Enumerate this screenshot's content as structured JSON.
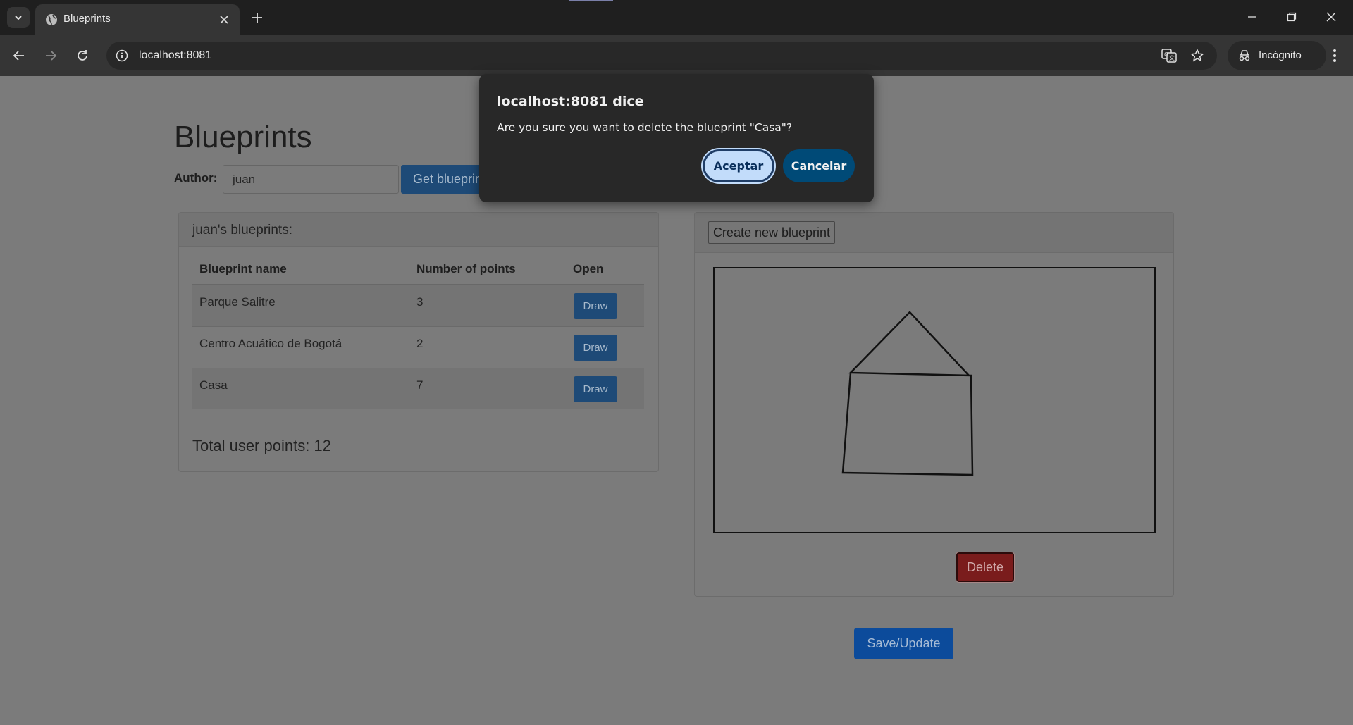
{
  "browser": {
    "tab_title": "Blueprints",
    "url": "localhost:8081",
    "incognito_label": "Incógnito",
    "icons": {
      "tab_list": "chevron-down-icon",
      "favicon": "globe-icon",
      "tab_close": "close-icon",
      "new_tab": "plus-icon",
      "minimize": "minimize-icon",
      "restore": "restore-icon",
      "close_window": "close-icon",
      "back": "arrow-left-icon",
      "forward": "arrow-right-icon",
      "reload": "reload-icon",
      "site_info": "info-icon",
      "translate": "translate-icon",
      "bookmark": "star-icon",
      "incognito": "incognito-icon",
      "menu": "kebab-menu-icon"
    }
  },
  "page": {
    "title": "Blueprints",
    "author_label": "Author:",
    "author_value": "juan",
    "get_button": "Get blueprints",
    "list_panel": {
      "heading": "juan's blueprints:",
      "columns": [
        "Blueprint name",
        "Number of points",
        "Open"
      ],
      "rows": [
        {
          "name": "Parque Salitre",
          "points": "3",
          "action": "Draw"
        },
        {
          "name": "Centro Acuático de Bogotá",
          "points": "2",
          "action": "Draw"
        },
        {
          "name": "Casa",
          "points": "7",
          "action": "Draw"
        }
      ],
      "total": "Total user points: 12"
    },
    "editor_panel": {
      "create_button": "Create new blueprint",
      "save_button": "Save/Update",
      "delete_button": "Delete"
    }
  },
  "dialog": {
    "title": "localhost:8081 dice",
    "message": "Are you sure you want to delete the blueprint \"Casa\"?",
    "ok_button": "Aceptar",
    "cancel_button": "Cancelar"
  },
  "colors": {
    "chrome_dark": "#1f1f1f",
    "toolbar": "#353535",
    "overlay_page": "#7b7b7b",
    "primary_button": "#1e4a77",
    "delete_button": "#7a1c1c",
    "dialog_bg": "#282828",
    "dialog_ok": "#c2dcfa",
    "dialog_cancel": "#004a77"
  }
}
